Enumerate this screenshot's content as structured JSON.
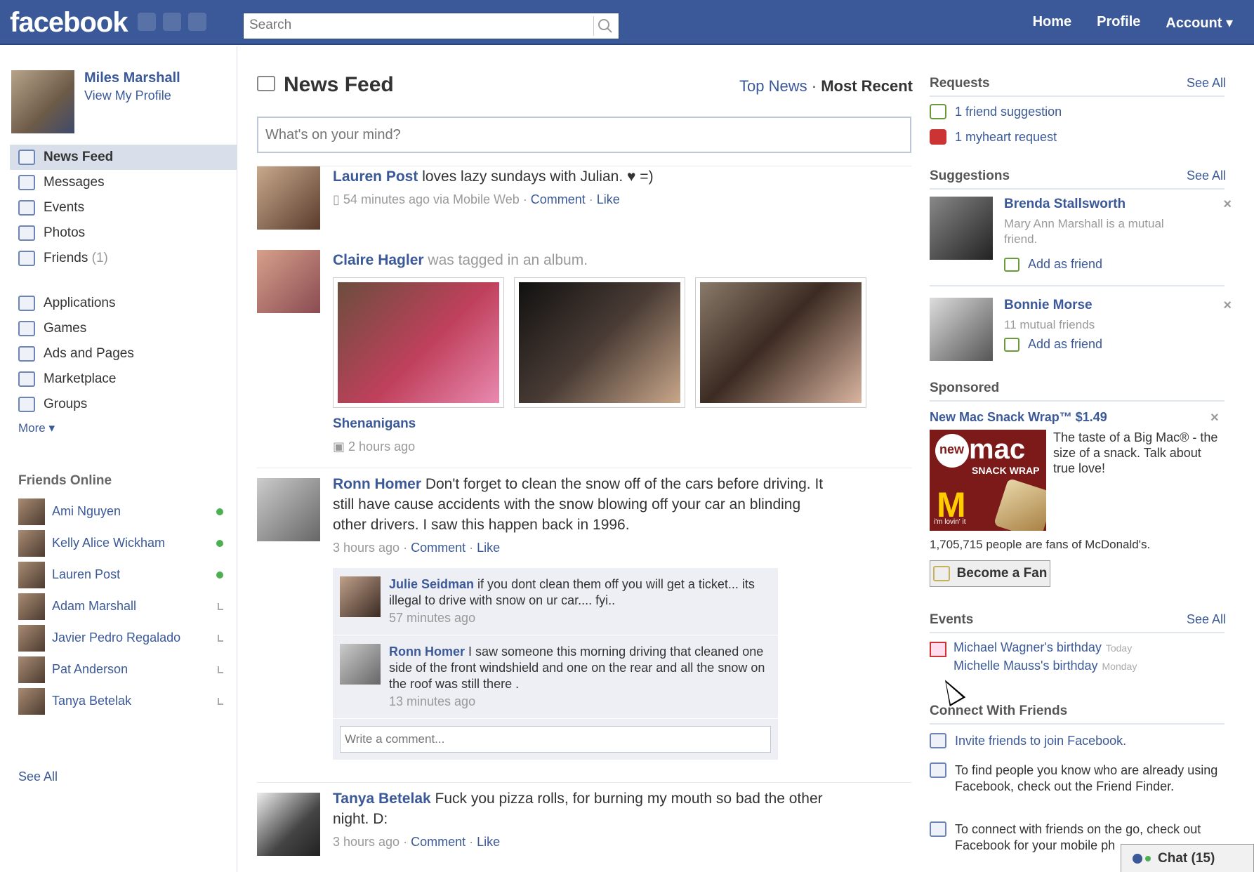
{
  "header": {
    "logo": "facebook",
    "search_placeholder": "Search",
    "nav": [
      "Home",
      "Profile",
      "Account ▾"
    ]
  },
  "profile": {
    "name": "Miles Marshall",
    "link": "View My Profile"
  },
  "left_nav": {
    "primary": [
      {
        "label": "News Feed",
        "icon": "news-feed-icon",
        "active": true
      },
      {
        "label": "Messages",
        "icon": "messages-icon"
      },
      {
        "label": "Events",
        "icon": "events-icon"
      },
      {
        "label": "Photos",
        "icon": "photos-icon"
      },
      {
        "label": "Friends",
        "count": "(1)",
        "icon": "friends-icon"
      }
    ],
    "secondary": [
      {
        "label": "Applications",
        "icon": "applications-icon"
      },
      {
        "label": "Games",
        "icon": "games-icon"
      },
      {
        "label": "Ads and Pages",
        "icon": "ads-icon"
      },
      {
        "label": "Marketplace",
        "icon": "marketplace-icon"
      },
      {
        "label": "Groups",
        "icon": "groups-icon"
      }
    ],
    "more": "More ▾"
  },
  "friends_online": {
    "title": "Friends Online",
    "friends": [
      {
        "name": "Ami Nguyen",
        "status": "online"
      },
      {
        "name": "Kelly Alice Wickham",
        "status": "online"
      },
      {
        "name": "Lauren Post",
        "status": "online"
      },
      {
        "name": "Adam Marshall",
        "status": "idle"
      },
      {
        "name": "Javier Pedro Regalado",
        "status": "idle"
      },
      {
        "name": "Pat Anderson",
        "status": "idle"
      },
      {
        "name": "Tanya Betelak",
        "status": "idle"
      }
    ],
    "see_all": "See All"
  },
  "feed": {
    "title": "News Feed",
    "filter_top": "Top News",
    "filter_sep": "·",
    "filter_recent": "Most Recent",
    "status_placeholder": "What's on your mind?",
    "stories": [
      {
        "actor": "Lauren Post",
        "text": " loves lazy sundays with Julian. ♥ =)",
        "time": "54 minutes ago via Mobile Web",
        "comment": "Comment",
        "like": "Like"
      },
      {
        "actor": "Claire Hagler",
        "text": " was tagged in an album.",
        "album": "Shenanigans",
        "time": "2 hours ago"
      },
      {
        "actor": "Ronn Homer",
        "text": " Don't forget to clean the snow off of the cars before driving. It still have cause accidents with the snow blowing off your car an blinding other drivers. I saw this happen back in 1996.",
        "time": "3 hours ago",
        "comment": "Comment",
        "like": "Like",
        "comments": [
          {
            "author": "Julie Seidman",
            "text": " if you dont clean them off you will get a ticket... its illegal to drive with snow on ur car.... fyi..",
            "time": "57 minutes ago"
          },
          {
            "author": "Ronn Homer",
            "text": " I saw someone this morning driving that cleaned one side of the front windshield and one on the rear and all the snow on the roof was still there .",
            "time": "13 minutes ago"
          }
        ],
        "write_placeholder": "Write a comment..."
      },
      {
        "actor": "Tanya Betelak",
        "text": " Fuck you pizza rolls, for burning my mouth so bad the other night. D:",
        "time": "3 hours ago",
        "comment": "Comment",
        "like": "Like"
      }
    ]
  },
  "right": {
    "requests": {
      "title": "Requests",
      "see_all": "See All",
      "items": [
        "1 friend suggestion",
        "1 myheart request"
      ]
    },
    "suggestions": {
      "title": "Suggestions",
      "see_all": "See All",
      "people": [
        {
          "name": "Brenda Stallsworth",
          "sub": "Mary Ann Marshall is a mutual friend.",
          "add": "Add as friend"
        },
        {
          "name": "Bonnie Morse",
          "sub": "11 mutual friends",
          "add": "Add as friend"
        }
      ]
    },
    "sponsored": {
      "title": "Sponsored",
      "ad_title": "New Mac Snack Wrap™ $1.49",
      "ad_text": "The taste of a Big Mac® - the size of a snack. Talk about true love!",
      "img_badge": "new",
      "img_mac": "mac",
      "img_snack": "SNACK WRAP",
      "img_arches": "M",
      "img_lovin": "i'm lovin' it",
      "fans": "1,705,715 people are fans of McDonald's.",
      "button": "Become a Fan"
    },
    "events": {
      "title": "Events",
      "see_all": "See All",
      "items": [
        {
          "name": "Michael Wagner's birthday",
          "day": "Today"
        },
        {
          "name": "Michelle Mauss's birthday",
          "day": "Monday"
        }
      ]
    },
    "connect": {
      "title": "Connect With Friends",
      "items": [
        "Invite friends to join Facebook.",
        "To find people you know who are already using Facebook, check out the Friend Finder.",
        "To connect with friends on the go, check out Facebook for your mobile ph"
      ]
    }
  },
  "chat": {
    "label": "Chat (15)"
  },
  "colors": {
    "brand": "#3b5998",
    "nav_active": "#d8dfea",
    "online": "#4caf50"
  }
}
